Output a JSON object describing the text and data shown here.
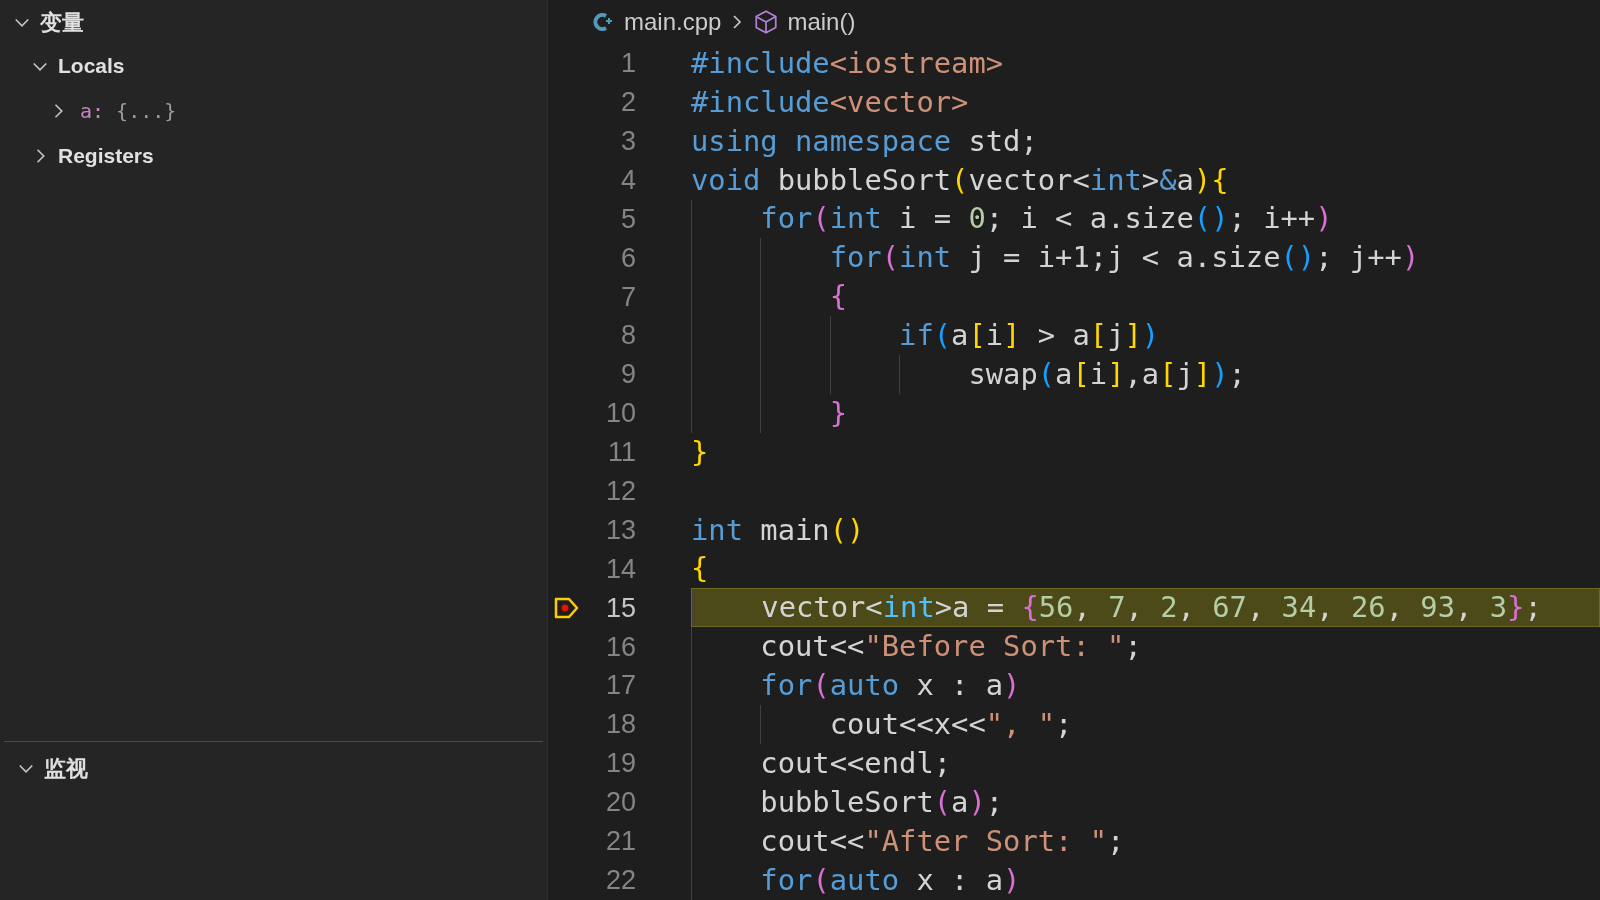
{
  "sidebar": {
    "sections": [
      {
        "title": "变量",
        "expanded": true,
        "children": [
          {
            "label": "Locals",
            "expanded": true,
            "children": [
              {
                "name": "a:",
                "value": "{...}",
                "expanded": false
              }
            ]
          },
          {
            "label": "Registers",
            "expanded": false
          }
        ]
      },
      {
        "title": "监视",
        "expanded": true
      }
    ]
  },
  "editor": {
    "breadcrumb": {
      "file": "main.cpp",
      "symbol": "main()"
    },
    "lines": [
      {
        "number": "1",
        "current": false,
        "tokens": [
          {
            "kind": "keyword",
            "text": "#include"
          },
          {
            "kind": "string",
            "text": "<iostream>"
          }
        ]
      },
      {
        "number": "2",
        "current": false,
        "tokens": [
          {
            "kind": "keyword",
            "text": "#include"
          },
          {
            "kind": "string",
            "text": "<vector>"
          }
        ]
      },
      {
        "number": "3",
        "current": false,
        "tokens": [
          {
            "kind": "keyword",
            "text": "using namespace"
          },
          {
            "kind": "text",
            "text": " std;"
          }
        ]
      },
      {
        "number": "4",
        "current": false,
        "tokens": [
          {
            "kind": "keyword",
            "text": "void"
          },
          {
            "kind": "text",
            "text": " bubbleSort"
          },
          {
            "kind": "brace1",
            "text": "("
          },
          {
            "kind": "text",
            "text": "vector<"
          },
          {
            "kind": "keyword",
            "text": "int"
          },
          {
            "kind": "text",
            "text": ">"
          },
          {
            "kind": "keyword",
            "text": "&"
          },
          {
            "kind": "text",
            "text": "a"
          },
          {
            "kind": "brace1",
            "text": "){"
          }
        ]
      },
      {
        "number": "5",
        "current": false,
        "tokens": [
          {
            "kind": "keyword",
            "text": "    for"
          },
          {
            "kind": "brace2",
            "text": "("
          },
          {
            "kind": "keyword",
            "text": "int"
          },
          {
            "kind": "text",
            "text": " i = "
          },
          {
            "kind": "number",
            "text": "0"
          },
          {
            "kind": "text",
            "text": "; i < a.size"
          },
          {
            "kind": "brace3",
            "text": "()"
          },
          {
            "kind": "text",
            "text": "; i++"
          },
          {
            "kind": "brace2",
            "text": ")"
          }
        ]
      },
      {
        "number": "6",
        "current": false,
        "tokens": [
          {
            "kind": "keyword",
            "text": "        for"
          },
          {
            "kind": "brace2",
            "text": "("
          },
          {
            "kind": "keyword",
            "text": "int"
          },
          {
            "kind": "text",
            "text": " j = i+1;j < a.size"
          },
          {
            "kind": "brace3",
            "text": "()"
          },
          {
            "kind": "text",
            "text": "; j++"
          },
          {
            "kind": "brace2",
            "text": ")"
          }
        ]
      },
      {
        "number": "7",
        "current": false,
        "tokens": [
          {
            "kind": "brace2",
            "text": "        {"
          }
        ]
      },
      {
        "number": "8",
        "current": false,
        "tokens": [
          {
            "kind": "keyword",
            "text": "            if"
          },
          {
            "kind": "brace3",
            "text": "("
          },
          {
            "kind": "text",
            "text": "a"
          },
          {
            "kind": "brace1",
            "text": "["
          },
          {
            "kind": "text",
            "text": "i"
          },
          {
            "kind": "brace1",
            "text": "]"
          },
          {
            "kind": "text",
            "text": " > a"
          },
          {
            "kind": "brace1",
            "text": "["
          },
          {
            "kind": "text",
            "text": "j"
          },
          {
            "kind": "brace1",
            "text": "]"
          },
          {
            "kind": "brace3",
            "text": ")"
          }
        ]
      },
      {
        "number": "9",
        "current": false,
        "tokens": [
          {
            "kind": "text",
            "text": "                swap"
          },
          {
            "kind": "brace3",
            "text": "("
          },
          {
            "kind": "text",
            "text": "a"
          },
          {
            "kind": "brace1",
            "text": "["
          },
          {
            "kind": "text",
            "text": "i"
          },
          {
            "kind": "brace1",
            "text": "]"
          },
          {
            "kind": "text",
            "text": ",a"
          },
          {
            "kind": "brace1",
            "text": "["
          },
          {
            "kind": "text",
            "text": "j"
          },
          {
            "kind": "brace1",
            "text": "]"
          },
          {
            "kind": "brace3",
            "text": ")"
          },
          {
            "kind": "text",
            "text": ";"
          }
        ]
      },
      {
        "number": "10",
        "current": false,
        "tokens": [
          {
            "kind": "brace2",
            "text": "        }"
          }
        ]
      },
      {
        "number": "11",
        "current": false,
        "tokens": [
          {
            "kind": "brace1",
            "text": "}"
          }
        ]
      },
      {
        "number": "12",
        "current": false
      },
      {
        "number": "13",
        "current": false,
        "tokens": [
          {
            "kind": "keyword",
            "text": "int"
          },
          {
            "kind": "text",
            "text": " main"
          },
          {
            "kind": "brace1",
            "text": "()"
          }
        ]
      },
      {
        "number": "14",
        "current": false,
        "tokens": [
          {
            "kind": "brace1",
            "text": "{"
          }
        ]
      },
      {
        "number": "15",
        "current": true,
        "tokens": [
          {
            "kind": "text",
            "text": "    vector<"
          },
          {
            "kind": "type",
            "text": "int"
          },
          {
            "kind": "text",
            "text": ">a = "
          },
          {
            "kind": "brace2",
            "text": "{"
          },
          {
            "kind": "number",
            "text": "56"
          },
          {
            "kind": "text",
            "text": ", "
          },
          {
            "kind": "number",
            "text": "7"
          },
          {
            "kind": "text",
            "text": ", "
          },
          {
            "kind": "number",
            "text": "2"
          },
          {
            "kind": "text",
            "text": ", "
          },
          {
            "kind": "number",
            "text": "67"
          },
          {
            "kind": "text",
            "text": ", "
          },
          {
            "kind": "number",
            "text": "34"
          },
          {
            "kind": "text",
            "text": ", "
          },
          {
            "kind": "number",
            "text": "26"
          },
          {
            "kind": "text",
            "text": ", "
          },
          {
            "kind": "number",
            "text": "93"
          },
          {
            "kind": "text",
            "text": ", "
          },
          {
            "kind": "number",
            "text": "3"
          },
          {
            "kind": "brace2",
            "text": "}"
          },
          {
            "kind": "text",
            "text": ";"
          }
        ]
      },
      {
        "number": "16",
        "current": false,
        "tokens": [
          {
            "kind": "text",
            "text": "    cout<<"
          },
          {
            "kind": "string",
            "text": "\"Before Sort: \""
          },
          {
            "kind": "text",
            "text": ";"
          }
        ]
      },
      {
        "number": "17",
        "current": false,
        "tokens": [
          {
            "kind": "keyword",
            "text": "    for"
          },
          {
            "kind": "brace2",
            "text": "("
          },
          {
            "kind": "keyword",
            "text": "auto"
          },
          {
            "kind": "text",
            "text": " x : a"
          },
          {
            "kind": "brace2",
            "text": ")"
          }
        ]
      },
      {
        "number": "18",
        "current": false,
        "tokens": [
          {
            "kind": "text",
            "text": "        cout<<x<<"
          },
          {
            "kind": "string",
            "text": "\", \""
          },
          {
            "kind": "text",
            "text": ";"
          }
        ]
      },
      {
        "number": "19",
        "current": false,
        "tokens": [
          {
            "kind": "text",
            "text": "    cout<<endl;"
          }
        ]
      },
      {
        "number": "20",
        "current": false,
        "tokens": [
          {
            "kind": "text",
            "text": "    bubbleSort"
          },
          {
            "kind": "brace2",
            "text": "("
          },
          {
            "kind": "text",
            "text": "a"
          },
          {
            "kind": "brace2",
            "text": ")"
          },
          {
            "kind": "text",
            "text": ";"
          }
        ]
      },
      {
        "number": "21",
        "current": false,
        "tokens": [
          {
            "kind": "text",
            "text": "    cout<<"
          },
          {
            "kind": "string",
            "text": "\"After Sort: \""
          },
          {
            "kind": "text",
            "text": ";"
          }
        ]
      },
      {
        "number": "22",
        "current": false,
        "tokens": [
          {
            "kind": "keyword",
            "text": "    for"
          },
          {
            "kind": "brace2",
            "text": "("
          },
          {
            "kind": "keyword",
            "text": "auto"
          },
          {
            "kind": "text",
            "text": " x : a"
          },
          {
            "kind": "brace2",
            "text": ")"
          }
        ]
      }
    ]
  }
}
